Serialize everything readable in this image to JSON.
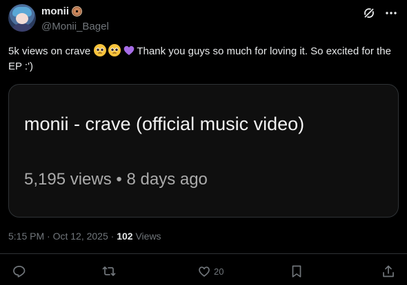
{
  "author": {
    "display_name": "monii",
    "handle": "@Monii_Bagel",
    "badge_icon": "bagel-emoji"
  },
  "top_actions": {
    "icons": [
      "grok-icon",
      "more-icon"
    ]
  },
  "tweet": {
    "text_part1": "5k views on crave",
    "emojis": [
      "pleading-face-emoji",
      "pleading-face-emoji",
      "purple-heart-emoji"
    ],
    "text_part2": "Thank you guys so much for loving it. So excited for the EP :')"
  },
  "card": {
    "title": "monii - crave (official music video)",
    "meta": "5,195 views • 8 days ago"
  },
  "footer": {
    "time": "5:15 PM",
    "date": "Oct 12, 2025",
    "views_count": "102",
    "views_label": "Views"
  },
  "actions": {
    "reply": {
      "icon": "reply-icon",
      "count": ""
    },
    "retweet": {
      "icon": "retweet-icon",
      "count": ""
    },
    "like": {
      "icon": "heart-icon",
      "count": "20"
    },
    "bookmark": {
      "icon": "bookmark-icon",
      "count": ""
    },
    "share": {
      "icon": "share-icon",
      "count": ""
    }
  },
  "colors": {
    "background": "#000000",
    "text": "#e7e9ea",
    "secondary": "#71767b",
    "border": "#2f3336"
  }
}
